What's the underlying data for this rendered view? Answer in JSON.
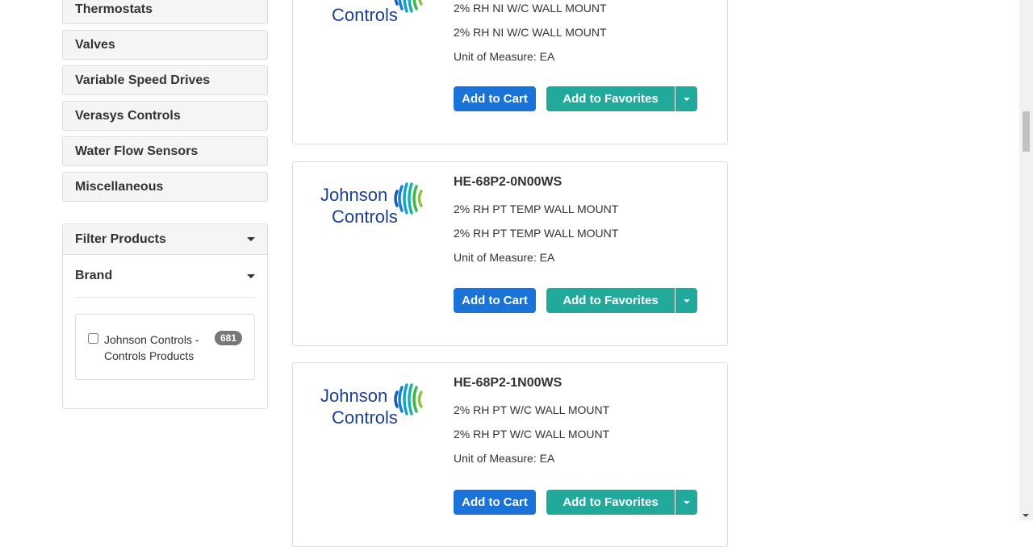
{
  "categories": [
    "Thermostats",
    "Valves",
    "Variable Speed Drives",
    "Verasys Controls",
    "Water Flow Sensors",
    "Miscellaneous"
  ],
  "filter": {
    "title": "Filter Products",
    "brand_title": "Brand",
    "brand_option": {
      "label": "Johnson Controls - Controls Products",
      "count": "681"
    }
  },
  "logo": {
    "line1": "Johnson",
    "line2": "Controls"
  },
  "products": [
    {
      "part": "",
      "desc1": "2% RH NI W/C WALL MOUNT",
      "desc2": "2% RH NI W/C WALL MOUNT",
      "uom": "Unit of Measure: EA"
    },
    {
      "part": "HE-68P2-0N00WS",
      "desc1": "2% RH PT TEMP WALL MOUNT",
      "desc2": "2% RH PT TEMP WALL MOUNT",
      "uom": "Unit of Measure: EA"
    },
    {
      "part": "HE-68P2-1N00WS",
      "desc1": "2% RH PT W/C WALL MOUNT",
      "desc2": "2% RH PT W/C WALL MOUNT",
      "uom": "Unit of Measure: EA"
    }
  ],
  "buttons": {
    "add_to_cart": "Add to Cart",
    "add_to_favorites": "Add to Favorites"
  },
  "colors": {
    "cart": "#1a73d9",
    "favorites": "#21a99c",
    "logo_text": "#1b3f94"
  }
}
